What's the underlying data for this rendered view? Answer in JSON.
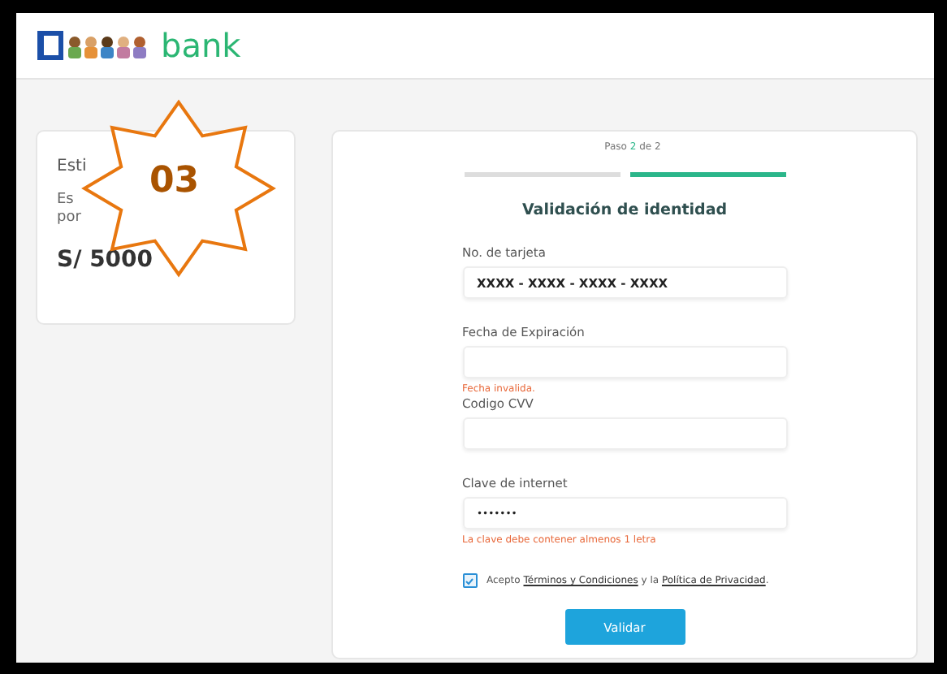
{
  "header": {
    "brand": "bank"
  },
  "summary_card": {
    "title": "Esti",
    "line_1": "Es",
    "line_2": "por",
    "amount": "S/ 5000"
  },
  "badge": {
    "number": "03"
  },
  "form": {
    "step": {
      "label": "Paso",
      "current": "2",
      "total": "de 2"
    },
    "segments": [
      {
        "active": false
      },
      {
        "active": true
      }
    ],
    "title": "Validación de identidad",
    "fields": [
      {
        "label": "No. de tarjeta",
        "value": "XXXX - XXXX - XXXX - XXXX",
        "kind": "text"
      },
      {
        "label": "Fecha de Expiración",
        "error": "Fecha invalida."
      },
      {
        "label": "Codigo CVV"
      },
      {
        "label": "Clave de internet",
        "value": "•••••••",
        "kind": "password",
        "error": "La clave debe contener almenos 1 letra"
      }
    ],
    "consent": {
      "checked": true,
      "before": "Acepto",
      "link_1": "Términos y Condiciones",
      "middle": "y la",
      "link_2": "Política de Privacidad",
      "after": "."
    },
    "submit": "Validar"
  }
}
